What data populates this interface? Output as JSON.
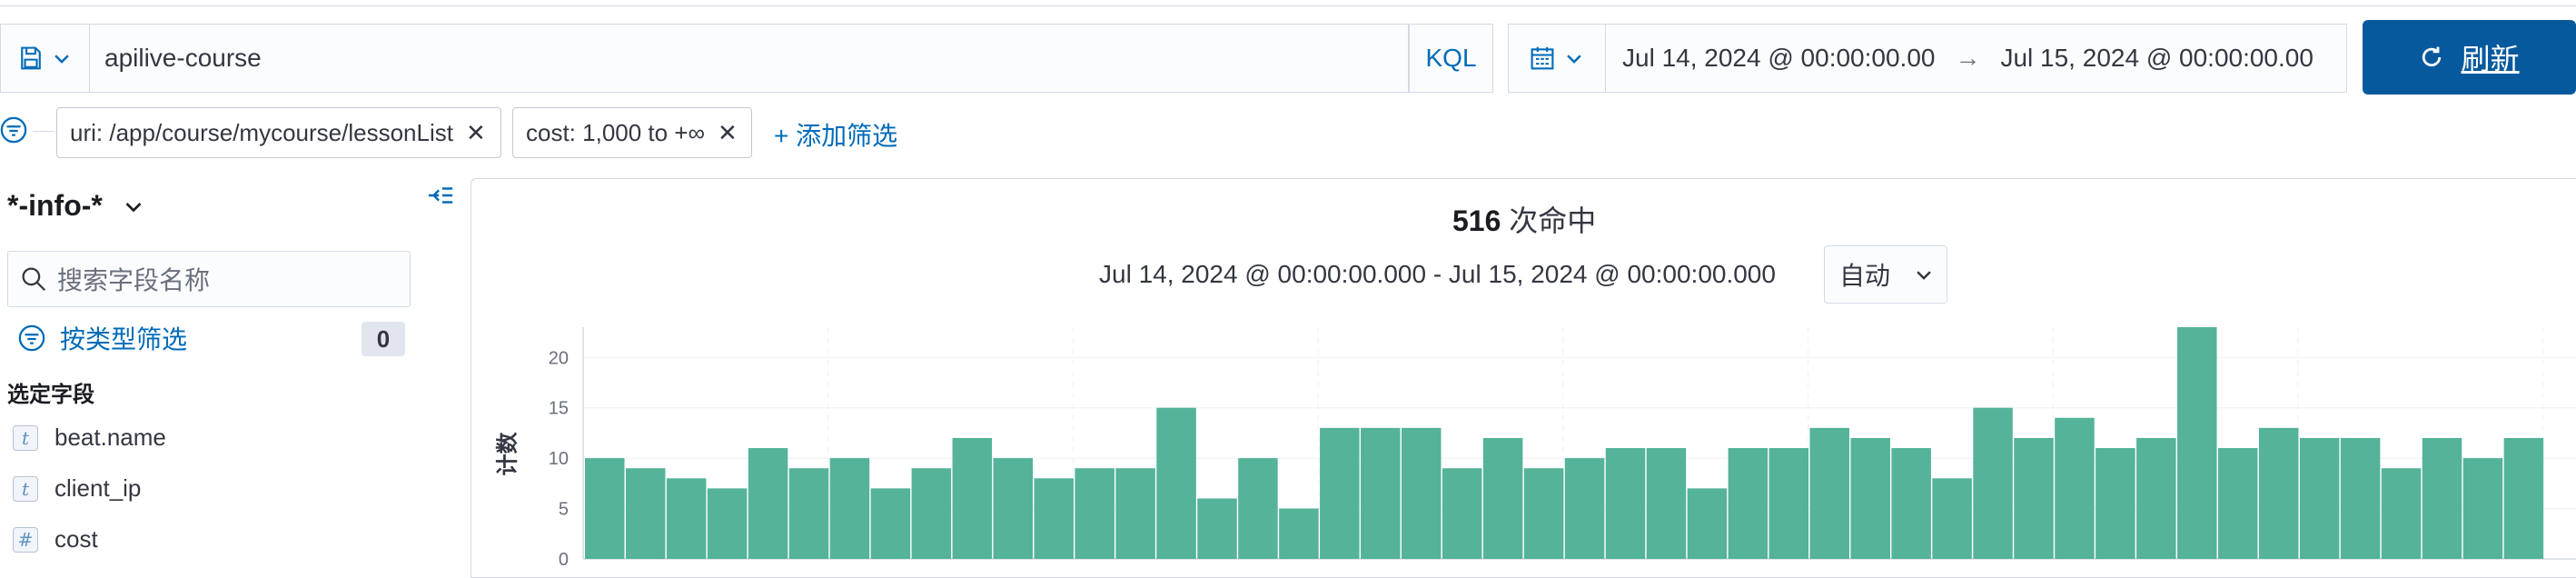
{
  "query_bar": {
    "query": "apilive-course",
    "language": "KQL",
    "date_start": "Jul 14, 2024 @ 00:00:00.00",
    "date_arrow": "→",
    "date_end": "Jul 15, 2024 @ 00:00:00.00",
    "refresh_label": "刷新"
  },
  "filters": {
    "pills": [
      {
        "label": "uri: /app/course/mycourse/lessonList"
      },
      {
        "label": "cost: 1,000 to +∞"
      }
    ],
    "add_label": "+ 添加筛选"
  },
  "sidebar": {
    "index_pattern": "*-info-*",
    "search_placeholder": "搜索字段名称",
    "type_filter_label": "按类型筛选",
    "type_filter_count": "0",
    "selected_heading": "选定字段",
    "fields": [
      {
        "token": "t",
        "name": "beat.name"
      },
      {
        "token": "t",
        "name": "client_ip"
      },
      {
        "token": "#",
        "name": "cost"
      }
    ]
  },
  "main": {
    "hits_count": "516",
    "hits_suffix": "次命中",
    "range_label": "Jul 14, 2024 @ 00:00:00.000 - Jul 15, 2024 @ 00:00:00.000",
    "interval": "自动"
  },
  "chart_data": {
    "type": "bar",
    "ylabel": "计数",
    "ylim": [
      0,
      23
    ],
    "yticks": [
      0,
      5,
      10,
      15,
      20
    ],
    "bar_color": "#54b399",
    "grid": true,
    "values": [
      10,
      9,
      8,
      7,
      11,
      9,
      10,
      7,
      9,
      12,
      10,
      8,
      9,
      9,
      15,
      6,
      10,
      5,
      13,
      13,
      13,
      9,
      12,
      9,
      10,
      11,
      11,
      7,
      11,
      11,
      13,
      12,
      11,
      8,
      15,
      12,
      14,
      11,
      12,
      23,
      11,
      13,
      12,
      12,
      9,
      12,
      10,
      12
    ]
  },
  "colors": {
    "accent": "#006bb8",
    "refresh_button": "#07599d",
    "bar": "#54b399"
  }
}
